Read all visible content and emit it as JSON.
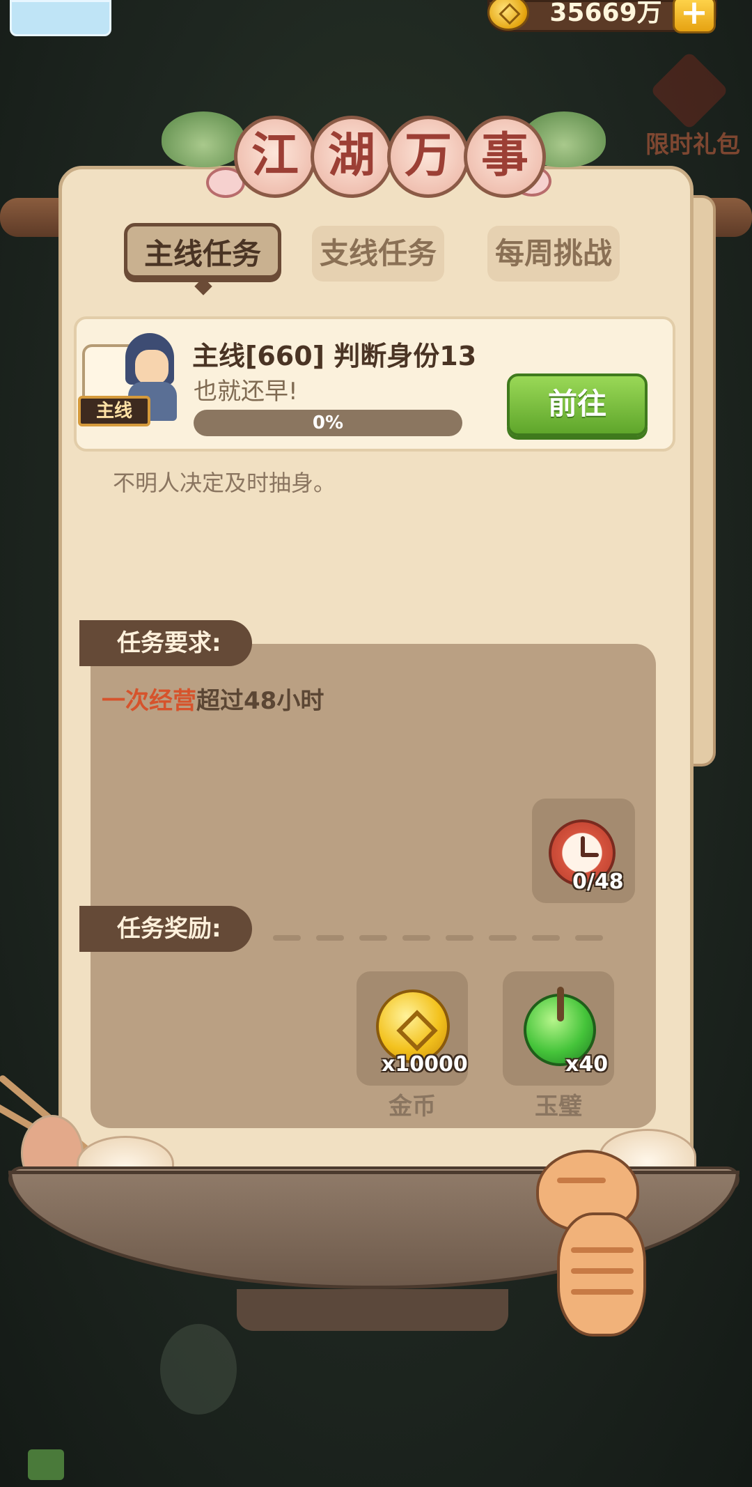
{
  "header": {
    "coin_amount": "35669万",
    "plus_label": "+",
    "side_gift_label": "限时礼包"
  },
  "panel": {
    "title_chars": [
      "江",
      "湖",
      "万",
      "事"
    ],
    "tabs": [
      {
        "label": "主线任务",
        "active": true
      },
      {
        "label": "支线任务",
        "active": false
      },
      {
        "label": "每周挑战",
        "active": false
      }
    ]
  },
  "task": {
    "badge": "主线",
    "title": "主线[660] 判断身份13",
    "subtitle": "也就还早!",
    "progress": 0,
    "progress_label": "0%",
    "go_button": "前往",
    "description": "不明人决定及时抽身。"
  },
  "requirement": {
    "label": "任务要求:",
    "highlight": "一次经营",
    "text": "超过48小时",
    "icon": "alarm-clock-icon",
    "count": "0/48"
  },
  "rewards": {
    "label": "任务奖励:",
    "items": [
      {
        "name": "金币",
        "count": "x10000",
        "icon": "gold-coin-icon"
      },
      {
        "name": "玉璧",
        "count": "x40",
        "icon": "jade-disc-icon"
      }
    ]
  },
  "colors": {
    "panel_bg": "#f1e0c2",
    "label_bg": "#654a37",
    "highlight": "#d6532c",
    "go_button": "#5fa62b"
  }
}
